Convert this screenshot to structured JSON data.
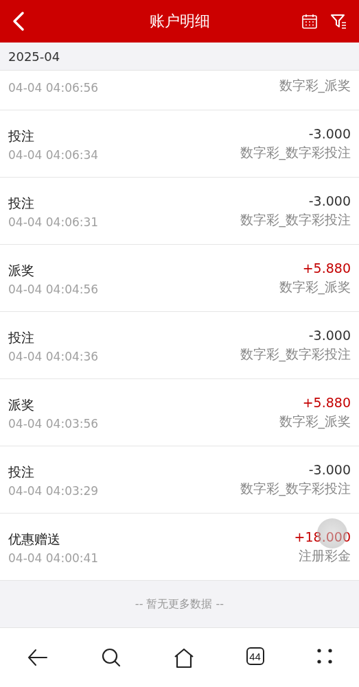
{
  "header": {
    "title": "账户明细"
  },
  "month": "2025-04",
  "records": [
    {
      "time": "04-04 04:06:56",
      "category": "数字彩_派奖"
    },
    {
      "title": "投注",
      "time": "04-04 04:06:34",
      "amount": "-3.000",
      "category": "数字彩_数字彩投注",
      "kind": "expense"
    },
    {
      "title": "投注",
      "time": "04-04 04:06:31",
      "amount": "-3.000",
      "category": "数字彩_数字彩投注",
      "kind": "expense"
    },
    {
      "title": "派奖",
      "time": "04-04 04:04:56",
      "amount": "+5.880",
      "category": "数字彩_派奖",
      "kind": "income"
    },
    {
      "title": "投注",
      "time": "04-04 04:04:36",
      "amount": "-3.000",
      "category": "数字彩_数字彩投注",
      "kind": "expense"
    },
    {
      "title": "派奖",
      "time": "04-04 04:03:56",
      "amount": "+5.880",
      "category": "数字彩_派奖",
      "kind": "income"
    },
    {
      "title": "投注",
      "time": "04-04 04:03:29",
      "amount": "-3.000",
      "category": "数字彩_数字彩投注",
      "kind": "expense"
    },
    {
      "title": "优惠赠送",
      "time": "04-04 04:00:41",
      "amount": "+18.000",
      "category": "注册彩金",
      "kind": "income"
    }
  ],
  "footer": "-- 暂无更多数据 --",
  "browser_bar": {
    "tabs_count": "44"
  }
}
